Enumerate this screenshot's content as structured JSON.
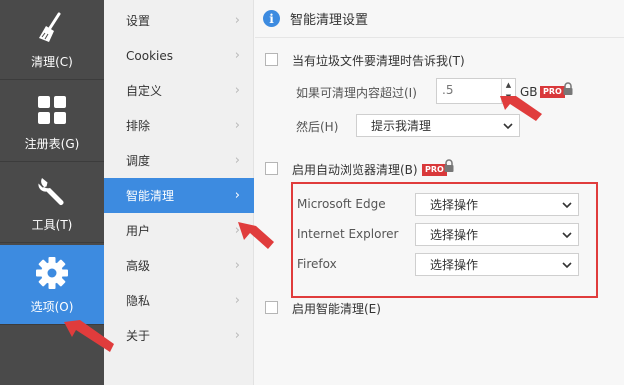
{
  "leftnav": [
    {
      "label": "清理(C)",
      "icon": "broom-icon"
    },
    {
      "label": "注册表(G)",
      "icon": "grid-icon"
    },
    {
      "label": "工具(T)",
      "icon": "wrench-icon"
    },
    {
      "label": "选项(O)",
      "icon": "gear-icon",
      "active": true
    }
  ],
  "midmenu": [
    {
      "label": "设置"
    },
    {
      "label": "Cookies"
    },
    {
      "label": "自定义"
    },
    {
      "label": "排除"
    },
    {
      "label": "调度"
    },
    {
      "label": "智能清理",
      "active": true
    },
    {
      "label": "用户"
    },
    {
      "label": "高级"
    },
    {
      "label": "隐私"
    },
    {
      "label": "关于"
    }
  ],
  "content": {
    "title": "智能清理设置",
    "notify_label": "当有垃圾文件要清理时告诉我(T)",
    "threshold_label": "如果可清理内容超过(I)",
    "threshold_value": ".5",
    "threshold_unit": "GB",
    "pro_badge": "PRO",
    "then_label": "然后(H)",
    "then_value": "提示我清理",
    "auto_browser_label": "启用自动浏览器清理(B)",
    "browsers": [
      {
        "name": "Microsoft Edge",
        "action": "选择操作"
      },
      {
        "name": "Internet Explorer",
        "action": "选择操作"
      },
      {
        "name": "Firefox",
        "action": "选择操作"
      }
    ],
    "smart_clean_label": "启用智能清理(E)"
  },
  "colors": {
    "accent": "#3d8be0",
    "sidebar_dark": "#4a4a4a",
    "annotation_red": "#e03c3c"
  }
}
